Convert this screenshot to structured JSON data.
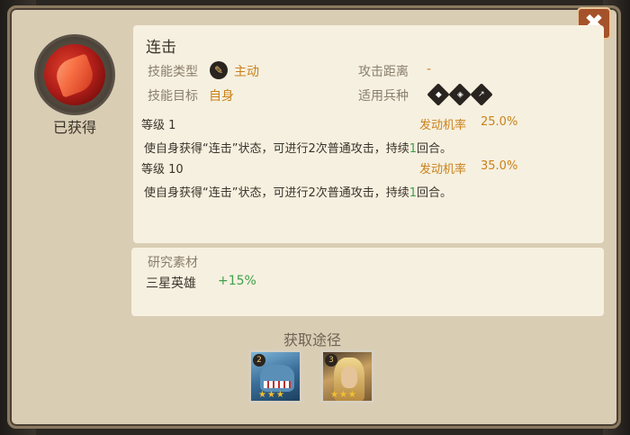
{
  "close": {
    "label": "✖"
  },
  "skill": {
    "name": "连击",
    "status": "已获得",
    "type_label": "技能类型",
    "type_value": "主动",
    "target_label": "技能目标",
    "target_value": "自身",
    "range_label": "攻击距离",
    "range_value": "-",
    "troop_label": "适用兵种",
    "troop_icons": [
      "troop-a-icon",
      "troop-b-icon",
      "troop-c-icon"
    ]
  },
  "levels": [
    {
      "level_label": "等级 1",
      "rate_label": "发动机率",
      "rate_value": "25.0%",
      "desc_pre": "使自身获得“连击”状态，可进行2次普通攻击，持续",
      "desc_num": "1",
      "desc_post": "回合。"
    },
    {
      "level_label": "等级 10",
      "rate_label": "发动机率",
      "rate_value": "35.0%",
      "desc_pre": "使自身获得“连击”状态，可进行2次普通攻击，持续",
      "desc_num": "1",
      "desc_post": "回合。"
    }
  ],
  "material": {
    "title": "研究素材",
    "name": "三星英雄",
    "bonus": "+15%"
  },
  "sources": {
    "title": "获取途径",
    "heroes": [
      {
        "icon": "shark-hero-portrait",
        "stars": "★★★",
        "badge": "2"
      },
      {
        "icon": "elf-hero-portrait",
        "stars": "★★★",
        "badge": "3"
      }
    ]
  }
}
